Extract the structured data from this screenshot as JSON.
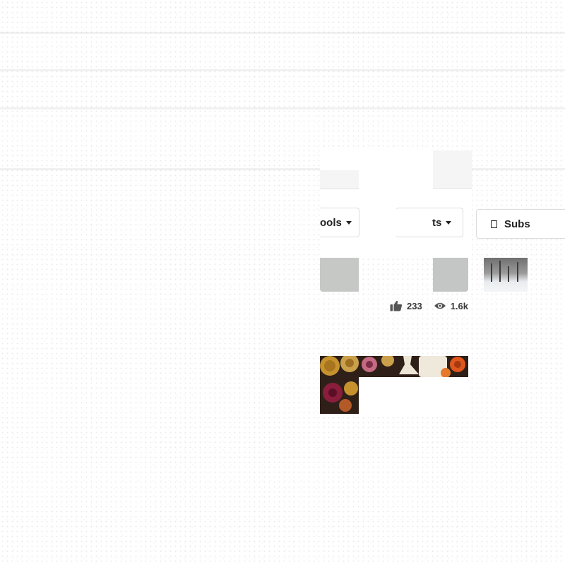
{
  "filters": {
    "tools_label": "ools",
    "assets_label": "ts",
    "subscribe_label": "Subs"
  },
  "stats": {
    "likes": "233",
    "views": "1.6k"
  },
  "colors": {
    "text": "#222222",
    "border": "#dcdcdc",
    "stat": "#3a3a3a"
  },
  "icons": [
    "caret-down-icon",
    "thumbs-up-icon",
    "eye-icon",
    "document-icon"
  ]
}
